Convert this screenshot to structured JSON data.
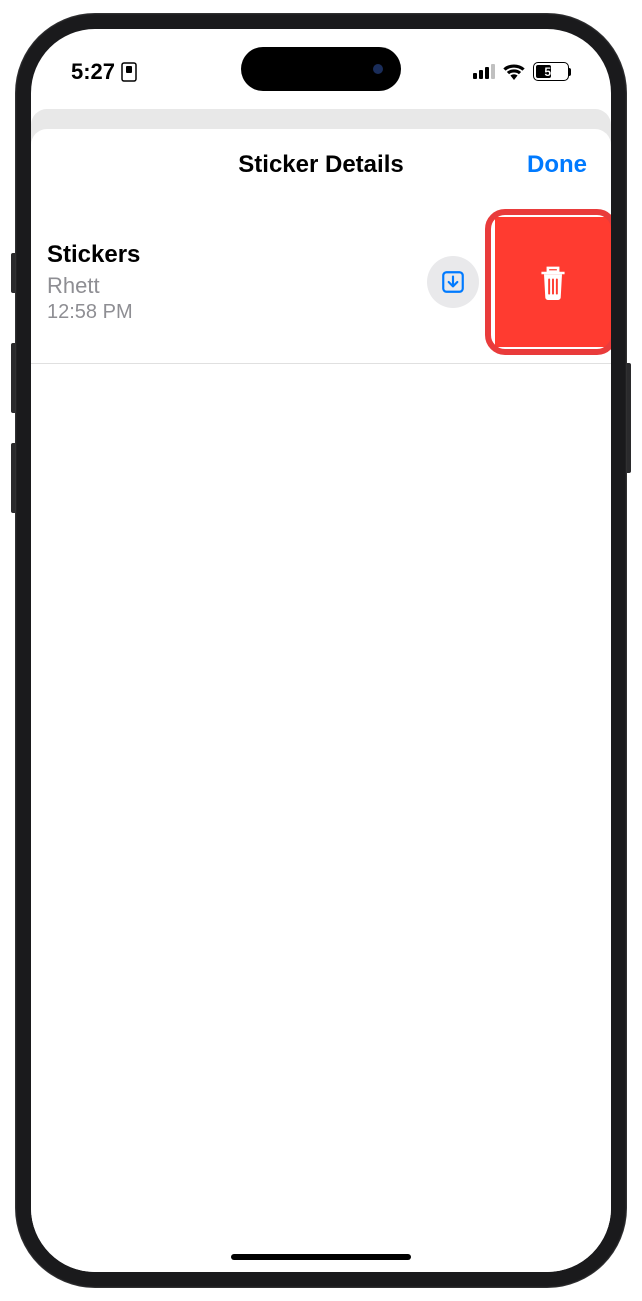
{
  "status_bar": {
    "time": "5:27",
    "battery_percent": "50"
  },
  "sheet": {
    "title": "Sticker Details",
    "done_label": "Done"
  },
  "sticker": {
    "name": "Stickers",
    "author": "Rhett",
    "time": "12:58 PM"
  }
}
